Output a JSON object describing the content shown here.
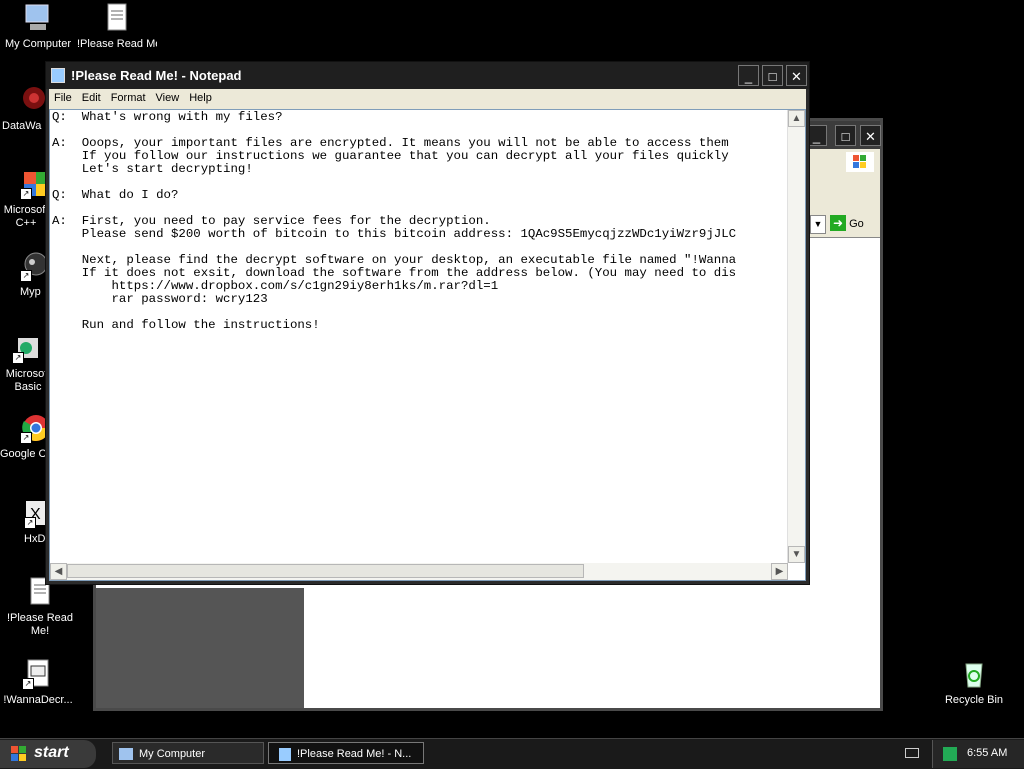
{
  "desktop": {
    "icons": [
      {
        "label": "My Computer"
      },
      {
        "label": "!Please Read Me!"
      },
      {
        "label": "DataWa"
      },
      {
        "label": "Microsoft C++"
      },
      {
        "label": "Myp"
      },
      {
        "label": "Microsoft Basic"
      },
      {
        "label": "Google C"
      },
      {
        "label": "HxD"
      },
      {
        "label": "!Please Read Me!"
      },
      {
        "label": "!WannaDecr..."
      },
      {
        "label": "Recycle Bin"
      }
    ]
  },
  "background_window": {
    "go_label": "Go"
  },
  "notepad": {
    "title": "!Please Read Me! - Notepad",
    "menu": [
      "File",
      "Edit",
      "Format",
      "View",
      "Help"
    ],
    "content": "Q:  What's wrong with my files?\n\nA:  Ooops, your important files are encrypted. It means you will not be able to access them\n    If you follow our instructions we guarantee that you can decrypt all your files quickly\n    Let's start decrypting!\n\nQ:  What do I do?\n\nA:  First, you need to pay service fees for the decryption.\n    Please send $200 worth of bitcoin to this bitcoin address: 1QAc9S5EmycqjzzWDc1yiWzr9jJLC\n\n    Next, please find the decrypt software on your desktop, an executable file named \"!Wanna\n    If it does not exsit, download the software from the address below. (You may need to dis\n        https://www.dropbox.com/s/c1gn29iy8erh1ks/m.rar?dl=1\n        rar password: wcry123\n\n    Run and follow the instructions!"
  },
  "taskbar": {
    "start_label": "start",
    "tasks": [
      {
        "label": "My Computer"
      },
      {
        "label": "!Please Read Me! - N..."
      }
    ],
    "clock": "6:55 AM"
  }
}
